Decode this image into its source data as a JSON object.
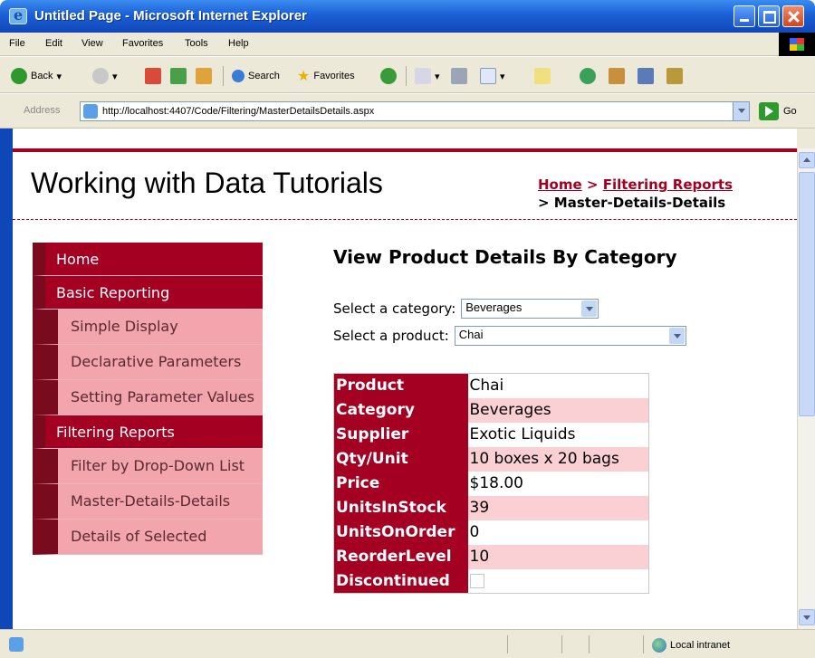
{
  "window": {
    "title": "Untitled Page - Microsoft Internet Explorer"
  },
  "menubar": {
    "items": [
      "File",
      "Edit",
      "View",
      "Favorites",
      "Tools",
      "Help"
    ]
  },
  "toolbar": {
    "back_label": "Back",
    "search_label": "Search",
    "favorites_label": "Favorites"
  },
  "address": {
    "label": "Address",
    "url": "http://localhost:4407/Code/Filtering/MasterDetailsDetails.aspx",
    "go_label": "Go"
  },
  "page": {
    "site_title": "Working with Data Tutorials",
    "breadcrumb": {
      "home": "Home",
      "sep": ">",
      "parent": "Filtering Reports",
      "current_prefix": "> ",
      "current": "Master-Details-Details"
    },
    "nav": [
      {
        "label": "Home",
        "level": "top"
      },
      {
        "label": "Basic Reporting",
        "level": "top"
      },
      {
        "label": "Simple Display",
        "level": "sub"
      },
      {
        "label": "Declarative Parameters",
        "level": "sub"
      },
      {
        "label": "Setting Parameter Values",
        "level": "sub"
      },
      {
        "label": "Filtering Reports",
        "level": "top"
      },
      {
        "label": "Filter by Drop-Down List",
        "level": "sub"
      },
      {
        "label": "Master-Details-Details",
        "level": "sub"
      },
      {
        "label": "Details of Selected",
        "level": "sub"
      }
    ],
    "heading": "View Product Details By Category",
    "category_label": "Select a category:",
    "category_value": "Beverages",
    "product_label": "Select a product:",
    "product_value": "Chai",
    "details": [
      {
        "label": "Product",
        "value": "Chai"
      },
      {
        "label": "Category",
        "value": "Beverages"
      },
      {
        "label": "Supplier",
        "value": "Exotic Liquids"
      },
      {
        "label": "Qty/Unit",
        "value": "10 boxes x 20 bags"
      },
      {
        "label": "Price",
        "value": "$18.00"
      },
      {
        "label": "UnitsInStock",
        "value": "39"
      },
      {
        "label": "UnitsOnOrder",
        "value": "0"
      },
      {
        "label": "ReorderLevel",
        "value": "10"
      },
      {
        "label": "Discontinued",
        "value": ""
      }
    ],
    "discontinued_checked": false
  },
  "status": {
    "zone": "Local intranet"
  }
}
